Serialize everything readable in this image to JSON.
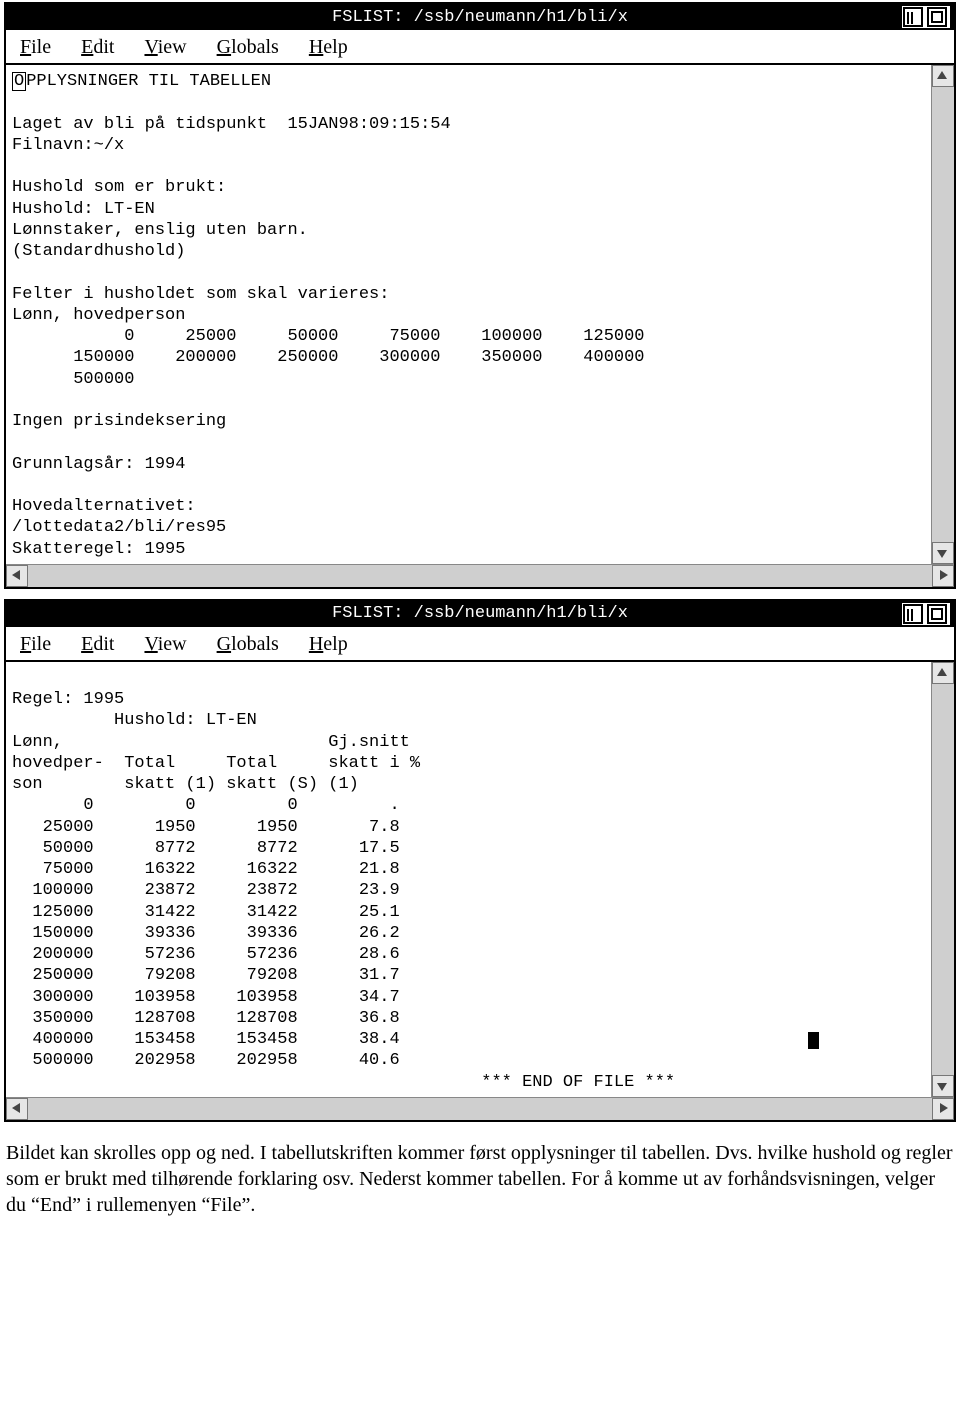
{
  "window1": {
    "title": "FSLIST: /ssb/neumann/h1/bli/x",
    "menu": [
      "File",
      "Edit",
      "View",
      "Globals",
      "Help"
    ],
    "lines": [
      "OPPLYSNINGER TIL TABELLEN",
      "",
      "Laget av bli på tidspunkt  15JAN98:09:15:54",
      "Filnavn:~/x",
      "",
      "Hushold som er brukt:",
      "Hushold: LT-EN",
      "Lønnstaker, enslig uten barn.",
      "(Standardhushold)",
      "",
      "Felter i husholdet som skal varieres:",
      "Lønn, hovedperson",
      "           0     25000     50000     75000    100000    125000",
      "      150000    200000    250000    300000    350000    400000",
      "      500000",
      "",
      "Ingen prisindeksering",
      "",
      "Grunnlagsår: 1994",
      "",
      "Hovedalternativet:",
      "/lottedata2/bli/res95",
      "Skatteregel: 1995"
    ]
  },
  "window2": {
    "title": "FSLIST: /ssb/neumann/h1/bli/x",
    "menu": [
      "File",
      "Edit",
      "View",
      "Globals",
      "Help"
    ],
    "header_lines": [
      "Regel: 1995",
      "          Hushold: LT-EN",
      "Lønn,                          Gj.snitt",
      "hovedper-  Total     Total     skatt i %",
      "son        skatt (1) skatt (S) (1)"
    ],
    "rows": [
      {
        "income": 0,
        "tax1": 0,
        "taxS": 0,
        "pct": "."
      },
      {
        "income": 25000,
        "tax1": 1950,
        "taxS": 1950,
        "pct": "7.8"
      },
      {
        "income": 50000,
        "tax1": 8772,
        "taxS": 8772,
        "pct": "17.5"
      },
      {
        "income": 75000,
        "tax1": 16322,
        "taxS": 16322,
        "pct": "21.8"
      },
      {
        "income": 100000,
        "tax1": 23872,
        "taxS": 23872,
        "pct": "23.9"
      },
      {
        "income": 125000,
        "tax1": 31422,
        "taxS": 31422,
        "pct": "25.1"
      },
      {
        "income": 150000,
        "tax1": 39336,
        "taxS": 39336,
        "pct": "26.2"
      },
      {
        "income": 200000,
        "tax1": 57236,
        "taxS": 57236,
        "pct": "28.6"
      },
      {
        "income": 250000,
        "tax1": 79208,
        "taxS": 79208,
        "pct": "31.7"
      },
      {
        "income": 300000,
        "tax1": 103958,
        "taxS": 103958,
        "pct": "34.7"
      },
      {
        "income": 350000,
        "tax1": 128708,
        "taxS": 128708,
        "pct": "36.8"
      },
      {
        "income": 400000,
        "tax1": 153458,
        "taxS": 153458,
        "pct": "38.4"
      },
      {
        "income": 500000,
        "tax1": 202958,
        "taxS": 202958,
        "pct": "40.6"
      }
    ],
    "eof": "*** END OF FILE ***"
  },
  "caption": "Bildet kan skrolles opp og ned. I tabellutskriften kommer først opplysninger til tabellen. Dvs. hvilke hushold og regler som er brukt med  tilhørende forklaring osv. Nederst kommer tabellen. For å komme ut av forhåndsvisningen, velger du “End” i rullemenyen “File”."
}
